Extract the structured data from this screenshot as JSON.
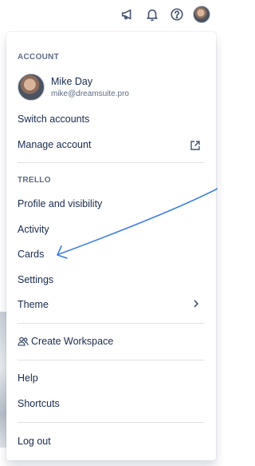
{
  "topbar": {
    "icons": [
      "megaphone-icon",
      "bell-icon",
      "help-icon",
      "avatar"
    ]
  },
  "account": {
    "section_label": "ACCOUNT",
    "name": "Mike Day",
    "email": "mike@dreamsuite.pro",
    "switch_label": "Switch accounts",
    "manage_label": "Manage account"
  },
  "trello": {
    "section_label": "TRELLO",
    "items": [
      {
        "label": "Profile and visibility"
      },
      {
        "label": "Activity"
      },
      {
        "label": "Cards"
      },
      {
        "label": "Settings"
      },
      {
        "label": "Theme"
      }
    ]
  },
  "workspace": {
    "create_label": "Create Workspace"
  },
  "support": {
    "help_label": "Help",
    "shortcuts_label": "Shortcuts"
  },
  "logout": {
    "label": "Log out"
  },
  "colors": {
    "text": "#172b4d",
    "muted": "#5e6c84",
    "divider": "#dfe1e6",
    "annotation_arrow": "#3b7de4"
  }
}
